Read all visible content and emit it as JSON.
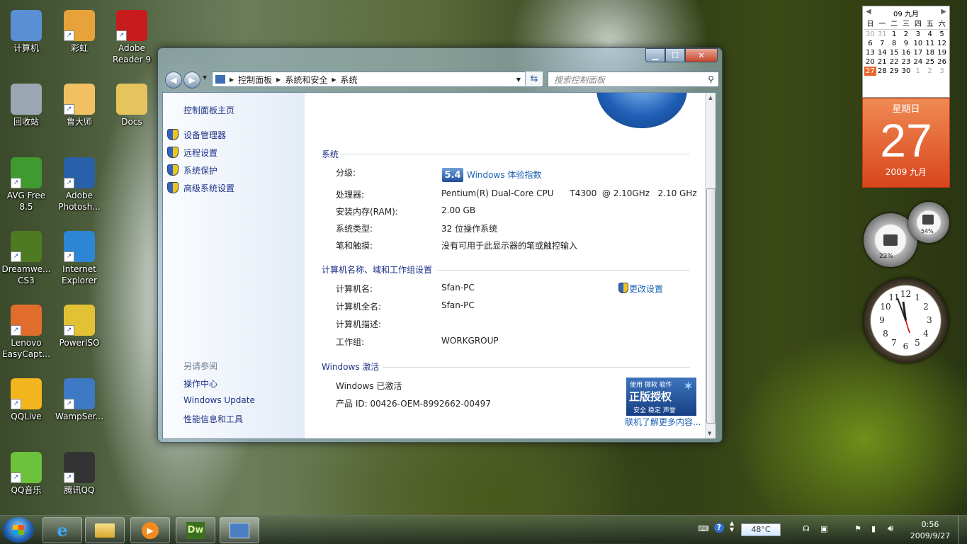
{
  "desktop": {
    "icons": [
      {
        "label": "计算机"
      },
      {
        "label": "彩虹"
      },
      {
        "label": "Adobe Reader 9"
      },
      {
        "label": "回收站"
      },
      {
        "label": "鲁大师"
      },
      {
        "label": "Docs"
      },
      {
        "label": "AVG Free 8.5"
      },
      {
        "label": "Adobe Photosh..."
      },
      {
        "label": "Dreamwe... CS3"
      },
      {
        "label": "Internet Explorer"
      },
      {
        "label": "Lenovo EasyCapt..."
      },
      {
        "label": "PowerISO"
      },
      {
        "label": "QQLive"
      },
      {
        "label": "WampSer..."
      },
      {
        "label": "QQ音乐"
      },
      {
        "label": "腾讯QQ"
      }
    ]
  },
  "window": {
    "breadcrumb": [
      "控制面板",
      "系统和安全",
      "系统"
    ],
    "search_placeholder": "搜索控制面板",
    "sidebar": {
      "home": "控制面板主页",
      "links": [
        "设备管理器",
        "远程设置",
        "系统保护",
        "高级系统设置"
      ],
      "see_also_title": "另请参阅",
      "see_also": [
        "操作中心",
        "Windows Update",
        "性能信息和工具"
      ]
    },
    "system": {
      "section": "系统",
      "rating_label": "分级:",
      "rating_score": "5.4",
      "rating_link": "Windows 体验指数",
      "cpu_label": "处理器:",
      "cpu_value": "Pentium(R) Dual-Core CPU      T4300  @ 2.10GHz   2.10 GHz",
      "ram_label": "安装内存(RAM):",
      "ram_value": "2.00 GB",
      "type_label": "系统类型:",
      "type_value": "32 位操作系统",
      "pen_label": "笔和触摸:",
      "pen_value": "没有可用于此显示器的笔或触控输入"
    },
    "computer": {
      "section": "计算机名称、域和工作组设置",
      "name_label": "计算机名:",
      "name_value": "Sfan-PC",
      "fullname_label": "计算机全名:",
      "fullname_value": "Sfan-PC",
      "desc_label": "计算机描述:",
      "workgroup_label": "工作组:",
      "workgroup_value": "WORKGROUP",
      "change_link": "更改设置"
    },
    "activation": {
      "section": "Windows 激活",
      "status": "Windows 已激活",
      "product_id": "产品 ID: 00426-OEM-8992662-00497",
      "genuine_top": "使用 微软 软件",
      "genuine_main": "正版授权",
      "genuine_sub": "安全 稳定 声誉",
      "more_link": "联机了解更多内容..."
    }
  },
  "calendar": {
    "month_header": "09 九月",
    "weekdays": [
      "日",
      "一",
      "二",
      "三",
      "四",
      "五",
      "六"
    ],
    "days": [
      "30",
      "31",
      "1",
      "2",
      "3",
      "4",
      "5",
      "6",
      "7",
      "8",
      "9",
      "10",
      "11",
      "12",
      "13",
      "14",
      "15",
      "16",
      "17",
      "18",
      "19",
      "20",
      "21",
      "22",
      "23",
      "24",
      "25",
      "26",
      "27",
      "28",
      "29",
      "30",
      "1",
      "2",
      "3"
    ],
    "weekday_name": "星期日",
    "day": "27",
    "year_month": "2009 九月"
  },
  "meters": {
    "cpu": "22%",
    "memory": "54%"
  },
  "taskbar": {
    "temperature": "48°C",
    "time": "0:56",
    "date": "2009/9/27"
  }
}
